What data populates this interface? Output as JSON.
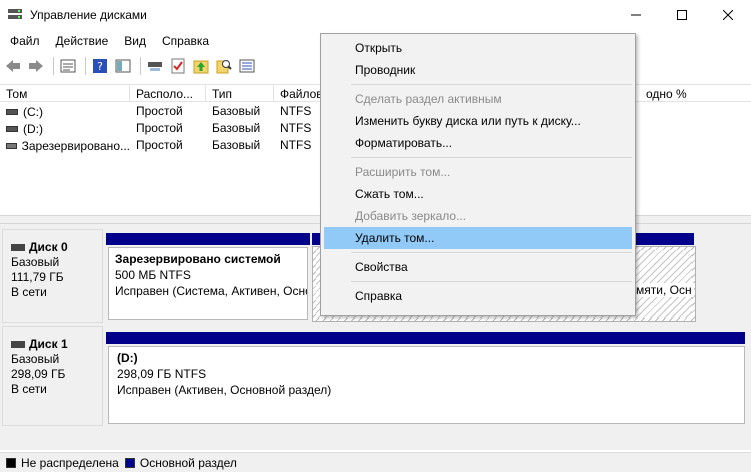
{
  "window": {
    "title": "Управление дисками",
    "minimize": "—",
    "maximize": "☐",
    "close": "✕"
  },
  "menubar": {
    "items": [
      "Файл",
      "Действие",
      "Вид",
      "Справка"
    ]
  },
  "toolbar": {
    "icons": [
      "back-arrow-icon",
      "forward-arrow-icon",
      "properties-icon",
      "help-icon",
      "console-tree-icon",
      "connect-icon",
      "check-icon",
      "upload-icon",
      "search-icon",
      "list-icon"
    ]
  },
  "volume_list": {
    "headers": [
      "Том",
      "Располо...",
      "Тип",
      "Файлов",
      "одно %"
    ],
    "rows": [
      {
        "tom": "(C:)",
        "loc": "Простой",
        "type": "Базовый",
        "fs": "NTFS"
      },
      {
        "tom": "(D:)",
        "loc": "Простой",
        "type": "Базовый",
        "fs": "NTFS"
      },
      {
        "tom": "Зарезервировано...",
        "loc": "Простой",
        "type": "Базовый",
        "fs": "NTFS"
      }
    ]
  },
  "disks": [
    {
      "name": "Диск 0",
      "kind": "Базовый",
      "size": "111,79 ГБ",
      "state": "В сети",
      "partitions": [
        {
          "name": "Зарезервировано системой",
          "size": "500 МБ NTFS",
          "status": "Исправен (Система, Активен, Осно"
        }
      ],
      "hidden_partition_tail": "мяти, Осн"
    },
    {
      "name": "Диск 1",
      "kind": "Базовый",
      "size": "298,09 ГБ",
      "state": "В сети",
      "partitions": [
        {
          "name": "(D:)",
          "size": "298,09 ГБ NTFS",
          "status": "Исправен (Активен, Основной раздел)"
        }
      ]
    }
  ],
  "legend": [
    {
      "label": "Не распределена",
      "color": "#000000"
    },
    {
      "label": "Основной раздел",
      "color": "#00008b"
    }
  ],
  "context_menu": {
    "items": [
      {
        "label": "Открыть",
        "disabled": false
      },
      {
        "label": "Проводник",
        "disabled": false
      },
      {
        "sep": true
      },
      {
        "label": "Сделать раздел активным",
        "disabled": true
      },
      {
        "label": "Изменить букву диска или путь к диску...",
        "disabled": false
      },
      {
        "label": "Форматировать...",
        "disabled": false
      },
      {
        "sep": true
      },
      {
        "label": "Расширить том...",
        "disabled": true
      },
      {
        "label": "Сжать том...",
        "disabled": false
      },
      {
        "label": "Добавить зеркало...",
        "disabled": true
      },
      {
        "label": "Удалить том...",
        "disabled": false,
        "highlighted": true
      },
      {
        "sep": true
      },
      {
        "label": "Свойства",
        "disabled": false
      },
      {
        "sep": true
      },
      {
        "label": "Справка",
        "disabled": false
      }
    ]
  }
}
